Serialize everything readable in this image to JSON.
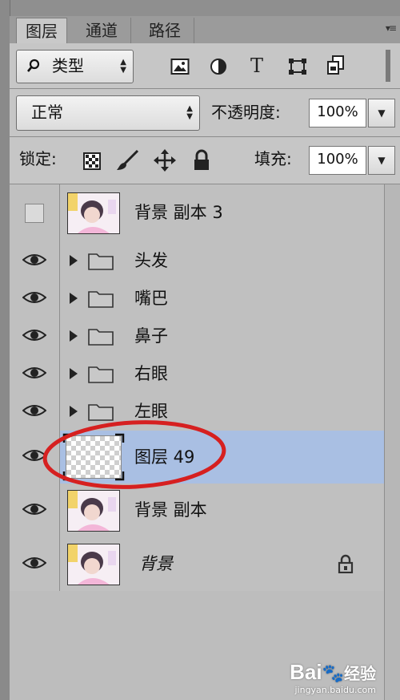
{
  "tabs": [
    {
      "label": "图层",
      "active": true
    },
    {
      "label": "通道",
      "active": false
    },
    {
      "label": "路径",
      "active": false
    }
  ],
  "filter": {
    "kind_label": "类型",
    "icons": [
      "image-filter-icon",
      "adjustment-filter-icon",
      "type-filter-icon",
      "shape-filter-icon",
      "smart-object-filter-icon"
    ]
  },
  "blend": {
    "mode": "正常"
  },
  "opacity": {
    "label": "不透明度:",
    "value": "100%"
  },
  "lock": {
    "label": "锁定:",
    "icons": [
      "lock-transparent-pixels-icon",
      "lock-image-pixels-icon",
      "lock-position-icon",
      "lock-all-icon"
    ]
  },
  "fill": {
    "label": "填充:",
    "value": "100%"
  },
  "layers": [
    {
      "name": "背景 副本 3",
      "type": "image",
      "visible": false,
      "selected": false,
      "locked": false
    },
    {
      "name": "头发",
      "type": "group",
      "visible": true,
      "selected": false,
      "locked": false
    },
    {
      "name": "嘴巴",
      "type": "group",
      "visible": true,
      "selected": false,
      "locked": false
    },
    {
      "name": "鼻子",
      "type": "group",
      "visible": true,
      "selected": false,
      "locked": false
    },
    {
      "name": "右眼",
      "type": "group",
      "visible": true,
      "selected": false,
      "locked": false
    },
    {
      "name": "左眼",
      "type": "group",
      "visible": true,
      "selected": false,
      "locked": false
    },
    {
      "name": "图层 49",
      "type": "empty",
      "visible": true,
      "selected": true,
      "locked": false
    },
    {
      "name": "背景 副本",
      "type": "image",
      "visible": true,
      "selected": false,
      "locked": false
    },
    {
      "name": "背景",
      "type": "image",
      "visible": true,
      "selected": false,
      "locked": true
    }
  ],
  "watermark": {
    "brand": "Bai",
    "brand2": "经验",
    "url": "jingyan.baidu.com"
  },
  "colors": {
    "selected_row": "#a9bfe3",
    "annotation_circle": "#d62020",
    "panel_bg": "#c6c6c6"
  }
}
